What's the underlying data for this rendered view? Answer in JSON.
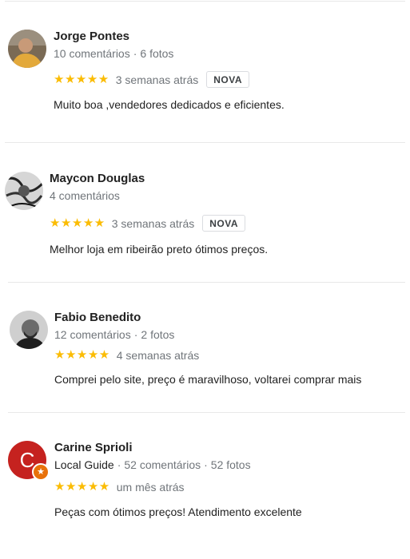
{
  "reviews": [
    {
      "name": "Jorge Pontes",
      "stats": [
        "10 comentários",
        "6 fotos"
      ],
      "stars": "★★★★★",
      "when": "3 semanas atrás",
      "badge": "NOVA",
      "text": "Muito boa ,vendedores dedicados e eficientes.",
      "avatar_icon": "person-photo-icon"
    },
    {
      "name": "Maycon Douglas",
      "stats": [
        "4 comentários"
      ],
      "stars": "★★★★★",
      "when": "3 semanas atrás",
      "badge": "NOVA",
      "text": "Melhor loja em ribeirão preto ótimos preços.",
      "avatar_icon": "bw-art-photo-icon"
    },
    {
      "name": "Fabio Benedito",
      "stats": [
        "12 comentários",
        "2 fotos"
      ],
      "stars": "★★★★★",
      "when": "4 semanas atrás",
      "text": "Comprei pelo site, preço é maravilhoso, voltarei comprar mais",
      "avatar_icon": "bw-person-photo-icon"
    },
    {
      "name": "Carine Sprioli",
      "initial": "C",
      "stats": [
        "Local Guide",
        "52 comentários",
        "52 fotos"
      ],
      "stars": "★★★★★",
      "when": "um mês atrás",
      "text": "Peças com ótimos preços! Atendimento excelente",
      "avatar_icon": "initial-letter-avatar-icon",
      "guide_icon": "local-guide-star-icon"
    }
  ],
  "colors": {
    "star": "#fbbc04",
    "meta": "#70757a",
    "initial_avatar": "#c5221f",
    "local_guide": "#e8710a"
  }
}
